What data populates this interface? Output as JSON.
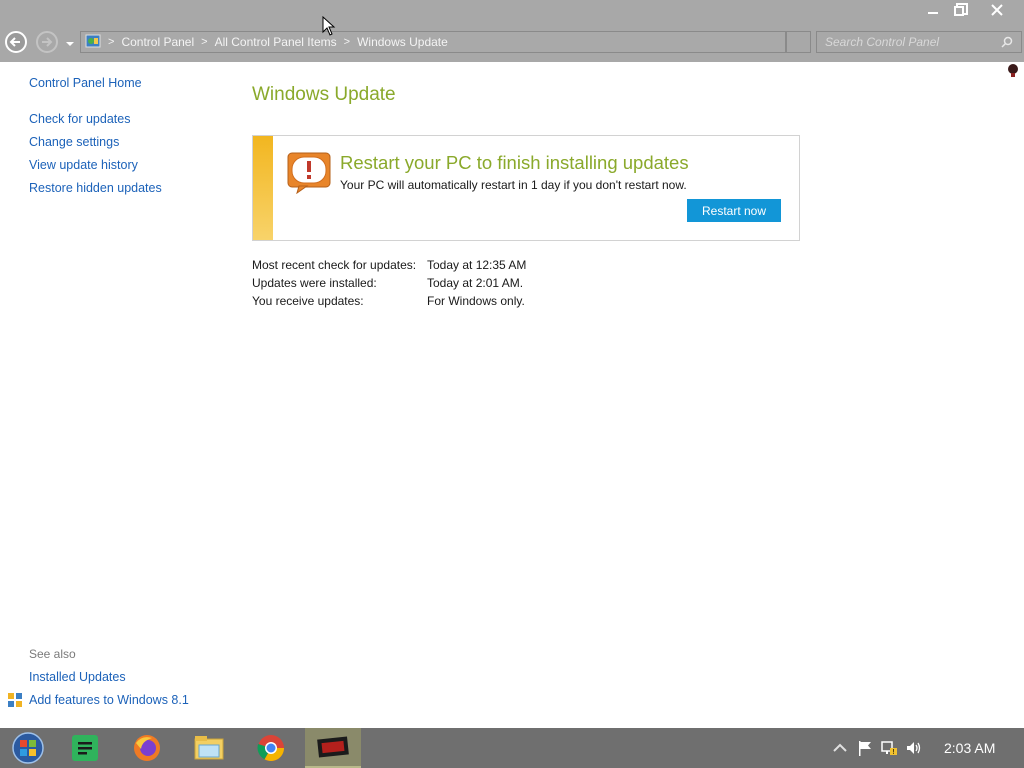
{
  "window": {
    "minimize_icon": "minimize-icon",
    "restore_icon": "restore-icon",
    "close_icon": "close-icon"
  },
  "address_bar": {
    "breadcrumb": [
      "Control Panel",
      "All Control Panel Items",
      "Windows Update"
    ],
    "search_placeholder": "Search Control Panel"
  },
  "sidebar": {
    "home": "Control Panel Home",
    "links": [
      "Check for updates",
      "Change settings",
      "View update history",
      "Restore hidden updates"
    ],
    "see_also_label": "See also",
    "see_also": [
      "Installed Updates",
      "Add features to Windows 8.1"
    ]
  },
  "main": {
    "title": "Windows Update",
    "notice": {
      "title": "Restart your PC to finish installing updates",
      "text": "Your PC will automatically restart in 1 day if you don't restart now.",
      "button": "Restart now"
    },
    "info": [
      {
        "label": "Most recent check for updates:",
        "value": "Today at 12:35 AM"
      },
      {
        "label": "Updates were installed:",
        "value": "Today at 2:01 AM."
      },
      {
        "label": "You receive updates:",
        "value": "For Windows only."
      }
    ]
  },
  "taskbar": {
    "apps": [
      "start-orb-icon",
      "spreadsheet-app-icon",
      "firefox-icon",
      "file-explorer-icon",
      "chrome-icon",
      "game-app-icon"
    ],
    "tray": [
      "show-hidden-icons-icon",
      "action-center-flag-icon",
      "network-icon",
      "volume-icon"
    ],
    "clock": "2:03 AM"
  },
  "colors": {
    "title_green": "#8aa92b",
    "link_blue": "#1c62b9",
    "button_blue": "#1296d7",
    "notice_bar": "#f2b620",
    "chrome_gray": "#a8a8a8",
    "taskbar": "#6f6f6f"
  }
}
